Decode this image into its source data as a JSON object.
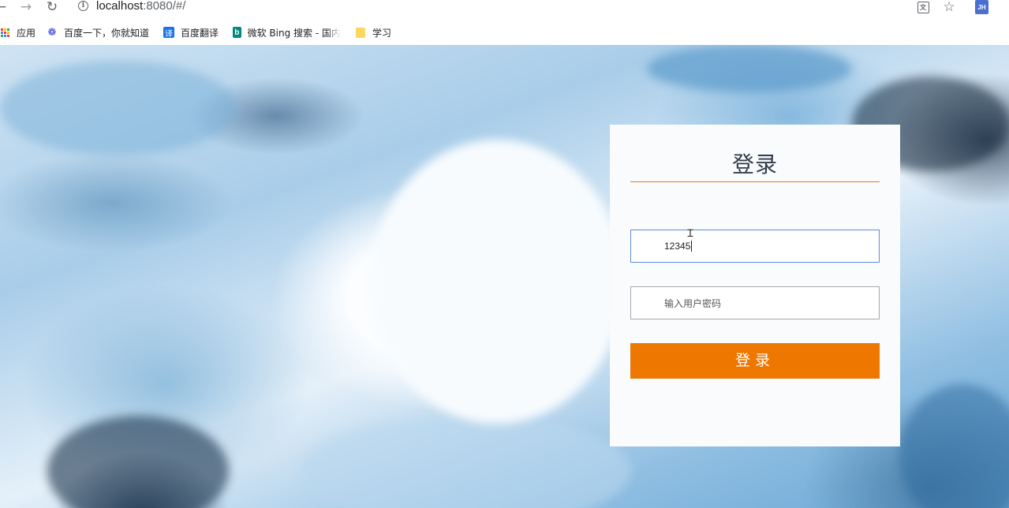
{
  "browser": {
    "url_host": "localhost",
    "url_path": ":8080/#/",
    "avatar_initials": "JH",
    "icons": {
      "back": "arrow-left-icon",
      "forward": "arrow-right-icon",
      "reload": "reload-icon",
      "info": "info-icon",
      "translate": "translate-icon",
      "bookmark_star": "star-icon"
    }
  },
  "bookmarks": [
    {
      "label": "应用",
      "icon": "apps-grid-icon"
    },
    {
      "label": "百度一下，你就知道",
      "icon": "baidu-paw-icon"
    },
    {
      "label": "百度翻译",
      "icon": "fanyi-icon"
    },
    {
      "label": "微软 Bing 搜索 - 国内",
      "icon": "bing-icon"
    },
    {
      "label": "学习",
      "icon": "folder-icon"
    }
  ],
  "login": {
    "title": "登录",
    "username_value": "12345",
    "password_placeholder": "输入用户密码",
    "submit_label": "登录"
  },
  "colors": {
    "accent": "#ee7700",
    "title_rule": "#e07b1c",
    "input_focus_border": "#5b8fd8",
    "card_background": "#f9fbfd"
  }
}
